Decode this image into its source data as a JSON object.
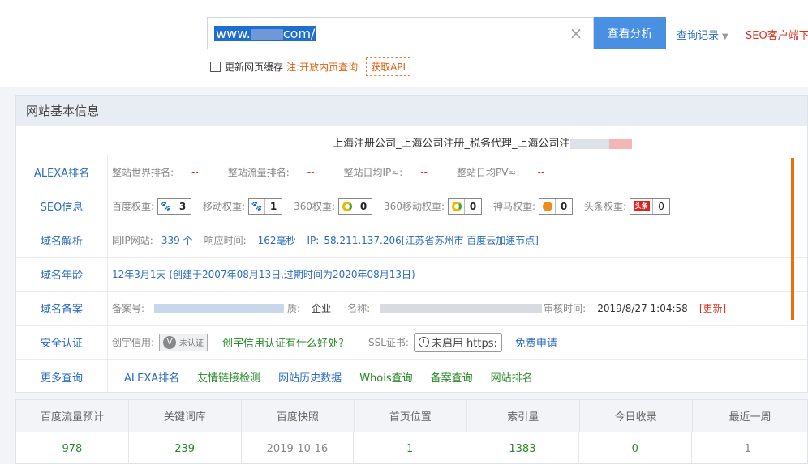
{
  "search": {
    "value_prefix": "www.",
    "value_suffix": "com/",
    "analyze_label": "查看分析",
    "history_label": "查询记录",
    "seo_client_label": "SEO客户端下"
  },
  "options": {
    "refresh_cache_label": "更新网页缓存",
    "note_prefix": "注:",
    "note_text": "开放内页查询",
    "api_label": "获取API"
  },
  "panel": {
    "title": "网站基本信息",
    "site_title": "上海注册公司_上海公司注册_税务代理_上海公司注"
  },
  "alexa": {
    "label": "ALEXA排名",
    "world_rank_label": "整站世界排名:",
    "world_rank_value": "--",
    "traffic_rank_label": "整站流量排名:",
    "traffic_rank_value": "--",
    "daily_ip_label": "整站日均IP≈:",
    "daily_ip_value": "--",
    "daily_pv_label": "整站日均PV≈:",
    "daily_pv_value": "--"
  },
  "seo": {
    "label": "SEO信息",
    "baidu_label": "百度权重:",
    "baidu_value": "3",
    "mobile_label": "移动权重:",
    "mobile_value": "1",
    "s360_label": "360权重:",
    "s360_value": "0",
    "s360_mobile_label": "360移动权重:",
    "s360_mobile_value": "0",
    "shenma_label": "神马权重:",
    "shenma_value": "0",
    "toutiao_label": "头条权重:",
    "toutiao_icon_text": "头条",
    "toutiao_value": "0"
  },
  "domain": {
    "label": "域名解析",
    "same_ip_label": "同IP网站:",
    "same_ip_value": "339 个",
    "response_label": "响应时间:",
    "response_value": "162毫秒",
    "ip_label": "IP:",
    "ip_value": "58.211.137.206[江苏省苏州市 百度云加速节点]"
  },
  "age": {
    "label": "域名年龄",
    "value": "12年3月1天 (创建于2007年08月13日,过期时间为2020年08月13日)"
  },
  "icp": {
    "label": "域名备案",
    "number_label": "备案号:",
    "nature_label": "质:",
    "nature_value": "企业",
    "name_label": "名称:",
    "audit_label": "审核时间:",
    "audit_value": "2019/8/27 1:04:58",
    "update_label": "[更新]"
  },
  "security": {
    "label": "安全认证",
    "chuangyu_label": "创宇信用:",
    "badge_letter": "V",
    "badge_text": "未认证",
    "benefit_link": "创宇信用认证有什么好处?",
    "ssl_label": "SSL证书:",
    "ssl_button": "未启用 https:",
    "apply_link": "免费申请"
  },
  "more": {
    "label": "更多查询",
    "links": [
      "ALEXA排名",
      "友情链接检测",
      "网站历史数据",
      "Whois查询",
      "备案查询",
      "网站排名"
    ]
  },
  "stats": {
    "headers": [
      "百度流量预计",
      "关键词库",
      "百度快照",
      "首页位置",
      "索引量",
      "今日收录",
      "最近一周"
    ],
    "values": [
      "978",
      "239",
      "2019-10-16",
      "1",
      "1383",
      "0",
      "1"
    ]
  },
  "colors": {
    "accent": "#4a90e2",
    "link": "#2a6bc0",
    "alert": "#e0301e",
    "good": "#2a8a2a"
  }
}
